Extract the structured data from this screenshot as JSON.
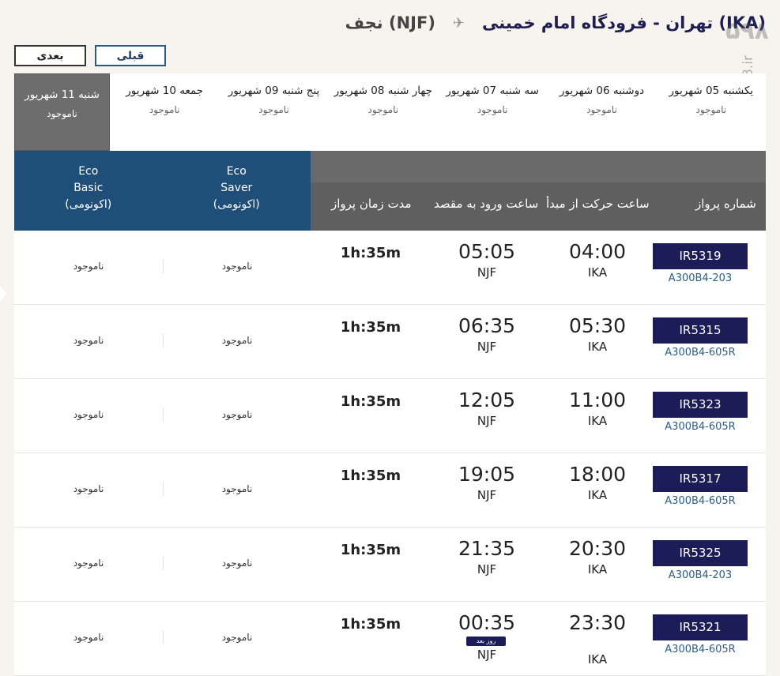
{
  "header": {
    "origin": "تهران - فرودگاه امام خمینی (IKA)",
    "destination": "نجف (NJF)",
    "watermark": "۵۹۸",
    "watermark_side": "598.ir"
  },
  "nav": {
    "next_label": "بعدی",
    "prev_label": "قبلی"
  },
  "dates": [
    {
      "label": "یکشنبه 05 شهریور",
      "status": "ناموجود"
    },
    {
      "label": "دوشنبه 06 شهریور",
      "status": "ناموجود"
    },
    {
      "label": "سه شنبه 07 شهریور",
      "status": "ناموجود"
    },
    {
      "label": "چهار شنبه 08 شهریور",
      "status": "ناموجود"
    },
    {
      "label": "پنج شنبه 09 شهریور",
      "status": "ناموجود"
    },
    {
      "label": "جمعه 10 شهریور",
      "status": "ناموجود"
    },
    {
      "label": "شنبه 11 شهریور",
      "status": "ناموجود"
    }
  ],
  "selected_date_index": 6,
  "table": {
    "headers": {
      "flight_no": "شماره پرواز",
      "departure": "ساعت حرکت از مبدأ",
      "arrival": "ساعت ورود به مقصد",
      "duration": "مدت زمان پرواز"
    },
    "fares": [
      {
        "line1": "Eco",
        "line2": "Basic",
        "line3": "(اکونومی)"
      },
      {
        "line1": "Eco",
        "line2": "Saver",
        "line3": "(اکونومی)"
      }
    ],
    "unavailable": "ناموجود",
    "next_day_label": "روز بعد",
    "rows": [
      {
        "flight": "IR5319",
        "aircraft": "A300B4-203",
        "dep": "04:00",
        "dep_apt": "IKA",
        "arr": "05:05",
        "arr_apt": "NJF",
        "duration": "1h:35m"
      },
      {
        "flight": "IR5315",
        "aircraft": "A300B4-605R",
        "dep": "05:30",
        "dep_apt": "IKA",
        "arr": "06:35",
        "arr_apt": "NJF",
        "duration": "1h:35m"
      },
      {
        "flight": "IR5323",
        "aircraft": "A300B4-605R",
        "dep": "11:00",
        "dep_apt": "IKA",
        "arr": "12:05",
        "arr_apt": "NJF",
        "duration": "1h:35m"
      },
      {
        "flight": "IR5317",
        "aircraft": "A300B4-605R",
        "dep": "18:00",
        "dep_apt": "IKA",
        "arr": "19:05",
        "arr_apt": "NJF",
        "duration": "1h:35m"
      },
      {
        "flight": "IR5325",
        "aircraft": "A300B4-203",
        "dep": "20:30",
        "dep_apt": "IKA",
        "arr": "21:35",
        "arr_apt": "NJF",
        "duration": "1h:35m"
      },
      {
        "flight": "IR5321",
        "aircraft": "A300B4-605R",
        "dep": "23:30",
        "dep_apt": "IKA",
        "arr": "00:35",
        "arr_apt": "NJF",
        "duration": "1h:35m",
        "next_day": true
      }
    ]
  },
  "colors": {
    "fare_header": "#1f4e78",
    "flight_badge": "#1c1c58",
    "table_header": "#5f5f5f"
  },
  "icons": {
    "route_separator": "plane-icon"
  }
}
